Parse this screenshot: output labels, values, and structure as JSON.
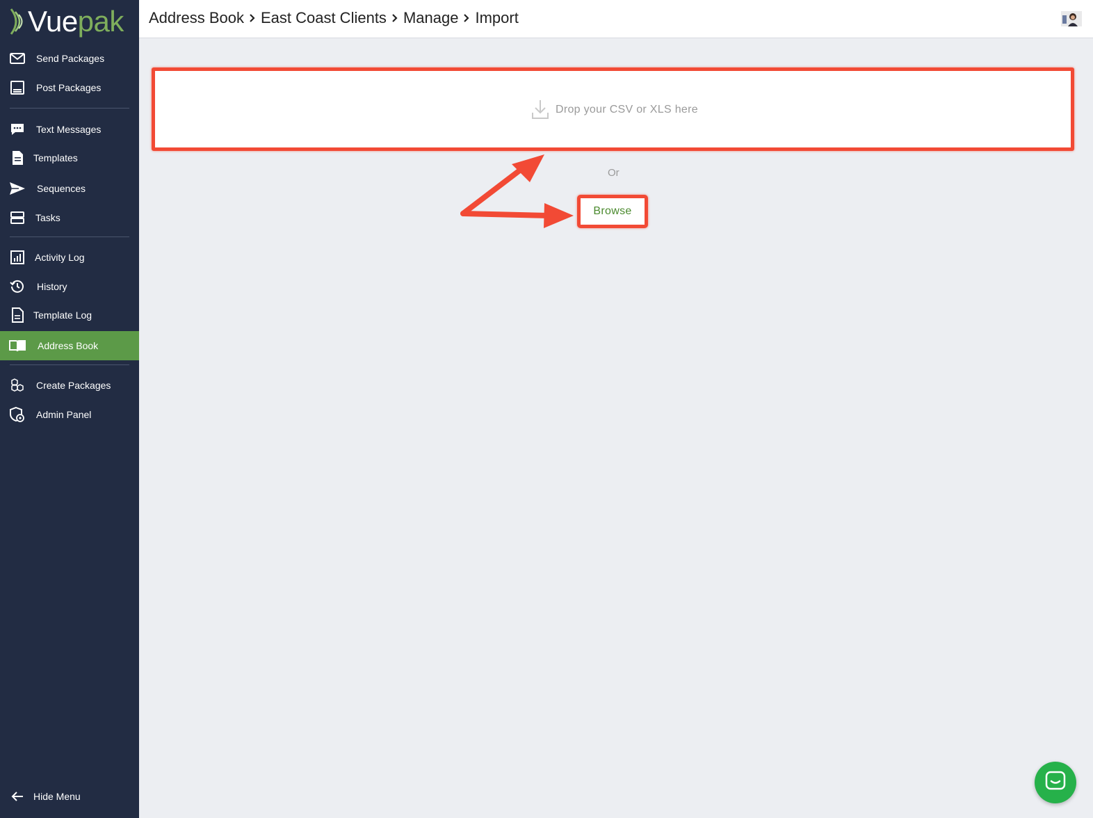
{
  "app": {
    "logo_prefix": "Vue",
    "logo_suffix": "pak",
    "brand_green": "#7fae5c",
    "active_green": "#5c9a48",
    "sidebar_bg": "#222c43",
    "annotation_red": "#f24a35"
  },
  "sidebar": {
    "items": [
      {
        "label": "Send Packages",
        "icon": "envelope-icon"
      },
      {
        "label": "Post Packages",
        "icon": "inbox-tray-icon"
      },
      {
        "label": "Text Messages",
        "icon": "chat-bubble-icon"
      },
      {
        "label": "Templates",
        "icon": "document-icon"
      },
      {
        "label": "Sequences",
        "icon": "paper-plane-icon"
      },
      {
        "label": "Tasks",
        "icon": "stacked-bars-icon"
      },
      {
        "label": "Activity Log",
        "icon": "bar-chart-icon"
      },
      {
        "label": "History",
        "icon": "clock-history-icon"
      },
      {
        "label": "Template Log",
        "icon": "document-lines-icon"
      },
      {
        "label": "Address Book",
        "icon": "open-book-icon",
        "active": true
      },
      {
        "label": "Create Packages",
        "icon": "boxes-icon"
      },
      {
        "label": "Admin Panel",
        "icon": "shield-gear-icon"
      }
    ],
    "hide_menu": "Hide Menu"
  },
  "breadcrumb": [
    "Address Book",
    "East Coast Clients",
    "Manage",
    "Import"
  ],
  "dropzone": {
    "text": "Drop your CSV or XLS here",
    "icon": "download-tray-icon"
  },
  "or_text": "Or",
  "browse_label": "Browse",
  "chat": {
    "icon": "chat-icon"
  }
}
